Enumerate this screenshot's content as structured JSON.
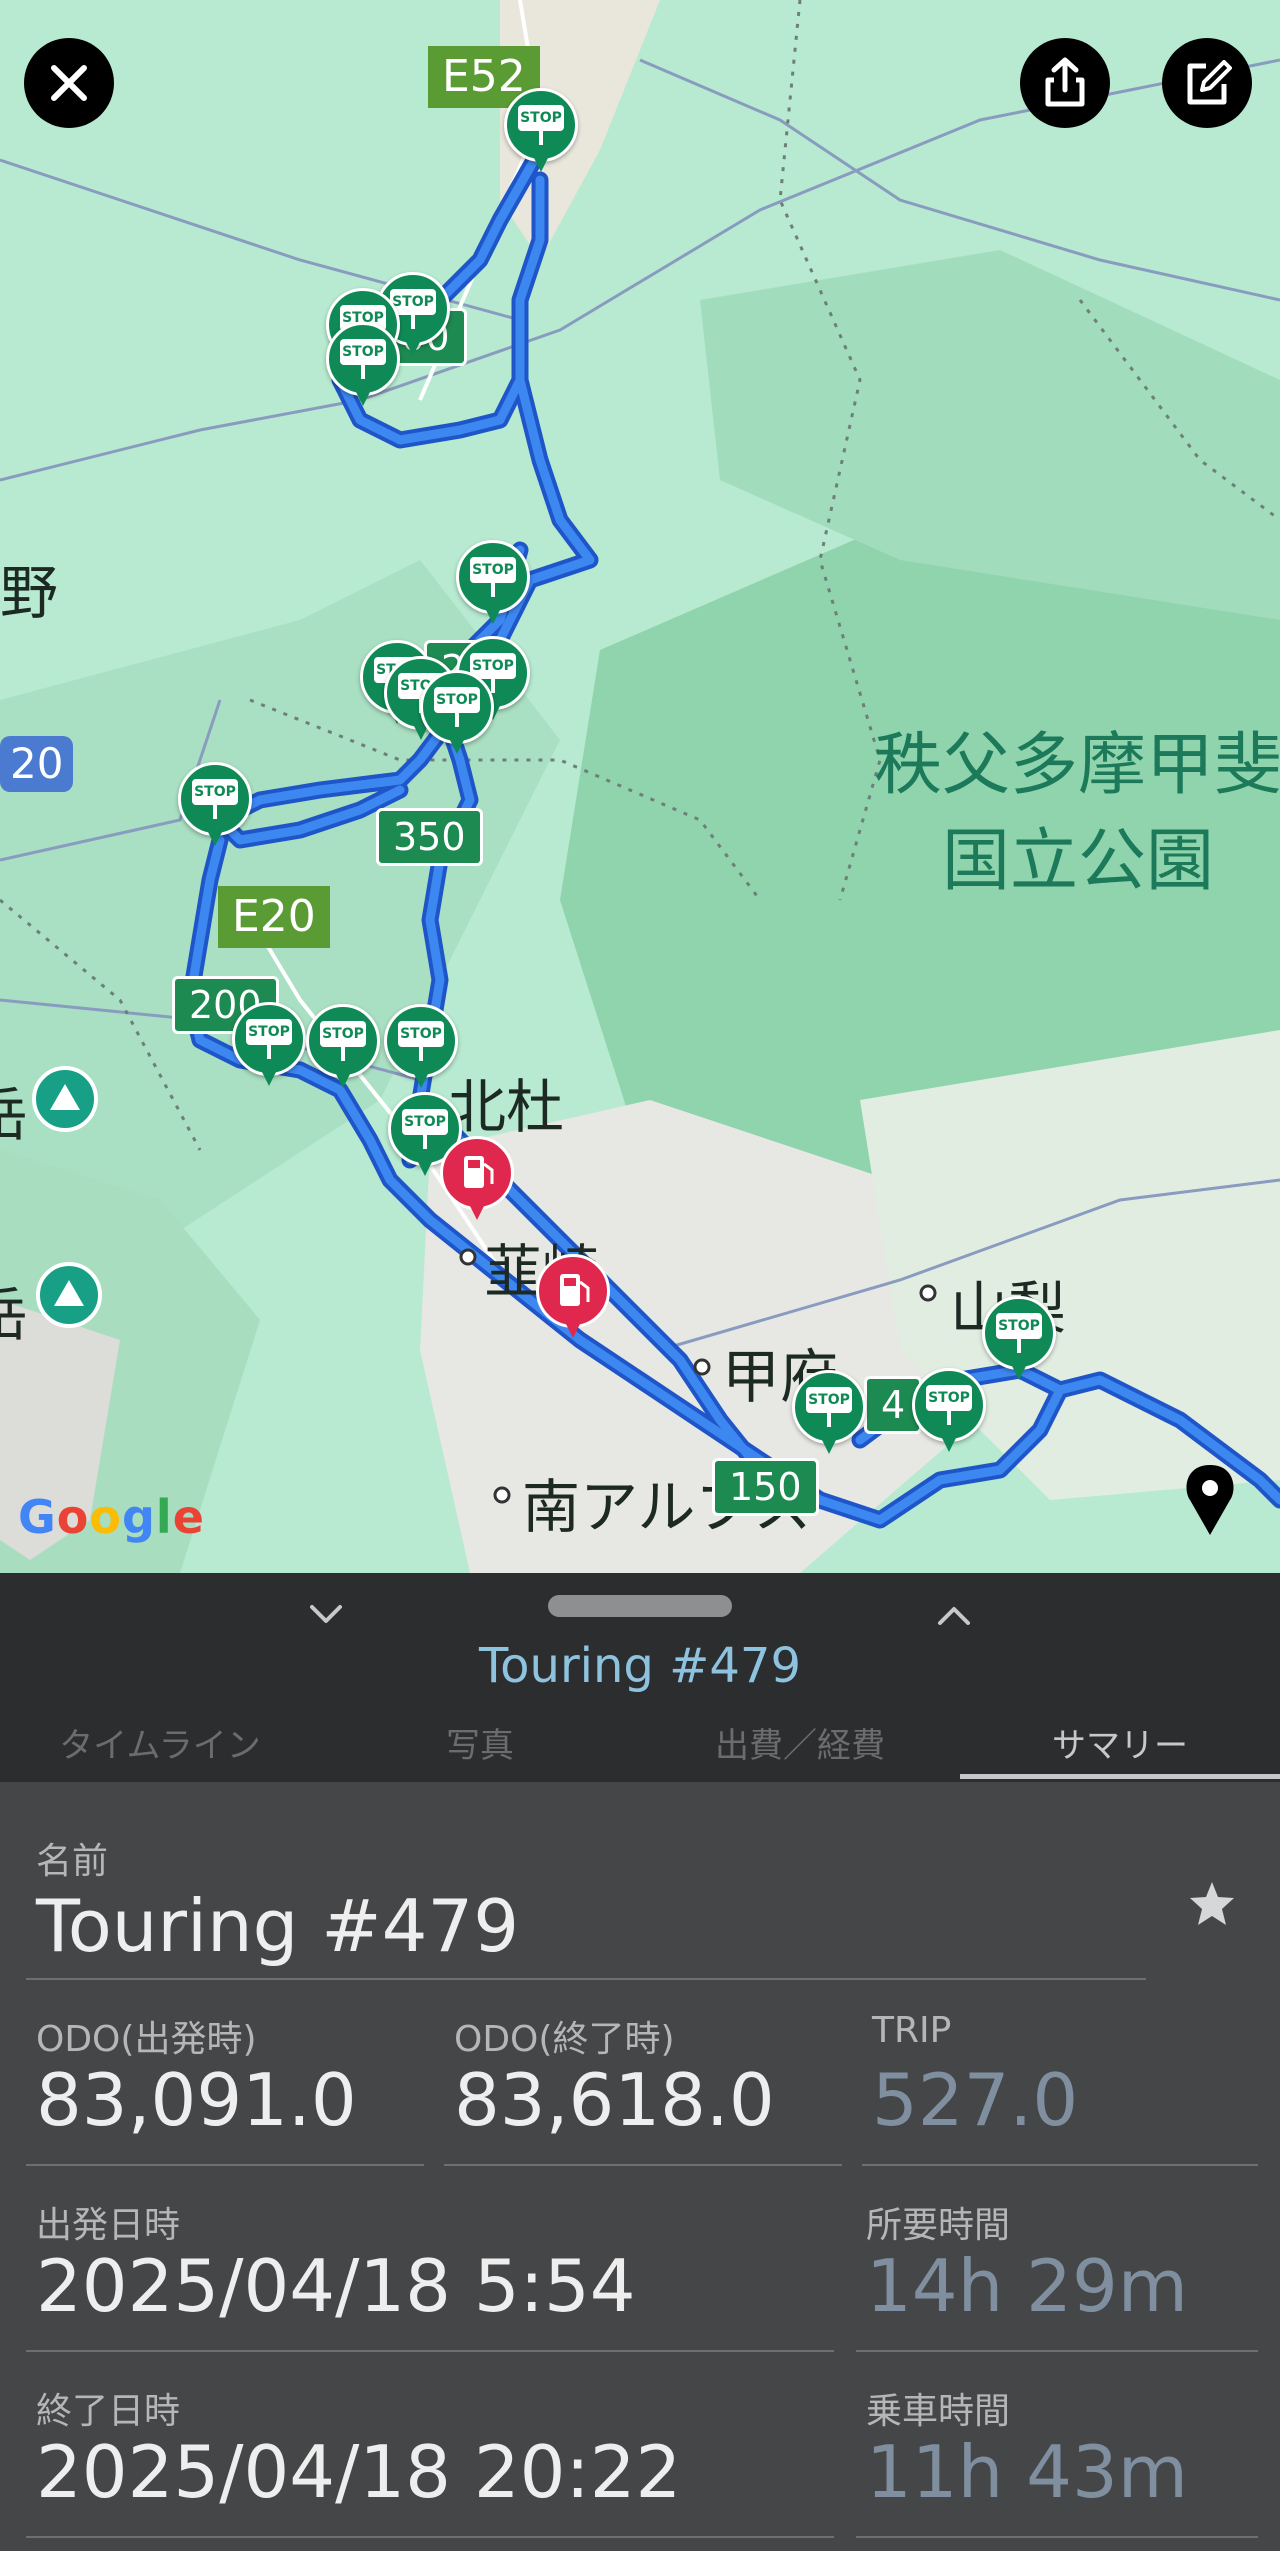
{
  "map": {
    "place_labels": [
      "北杜",
      "韮崎",
      "甲府",
      "山梨",
      "南アルプス",
      "野",
      "岳",
      "岳"
    ],
    "park_label": [
      "秩父多摩甲斐",
      "国立公園"
    ],
    "expressway_shields": [
      "E52",
      "E20"
    ],
    "road_shields": [
      "200",
      "350",
      "200",
      "150",
      "4",
      "2"
    ],
    "route_shield": "20",
    "stop_sign_text": "STOP",
    "attribution": [
      "G",
      "o",
      "o",
      "g",
      "l",
      "e"
    ]
  },
  "toolbar": {
    "close_icon": "close-icon",
    "share_icon": "share-icon",
    "edit_icon": "edit-icon"
  },
  "sheet": {
    "title": "Touring #479",
    "tabs": [
      {
        "label": "タイムライン",
        "active": false
      },
      {
        "label": "写真",
        "active": false
      },
      {
        "label": "出費／経費",
        "active": false
      },
      {
        "label": "サマリー",
        "active": true
      }
    ]
  },
  "summary": {
    "name_label": "名前",
    "name_value": "Touring #479",
    "odo_start_label": "ODO(出発時)",
    "odo_start_value": "83,091.0",
    "odo_end_label": "ODO(終了時)",
    "odo_end_value": "83,618.0",
    "trip_label": "TRIP",
    "trip_value": "527.0",
    "depart_label": "出発日時",
    "depart_value": "2025/04/18 5:54",
    "duration_label": "所要時間",
    "duration_value": "14h 29m",
    "end_label": "終了日時",
    "end_value": "2025/04/18 20:22",
    "ride_label": "乗車時間",
    "ride_value": "11h 43m"
  },
  "colors": {
    "route": "#2f6fe0",
    "stop_pin": "#0f8a56",
    "fuel_pin": "#e0284e",
    "title": "#8ec3df",
    "muted_value": "#7f8fa0"
  }
}
